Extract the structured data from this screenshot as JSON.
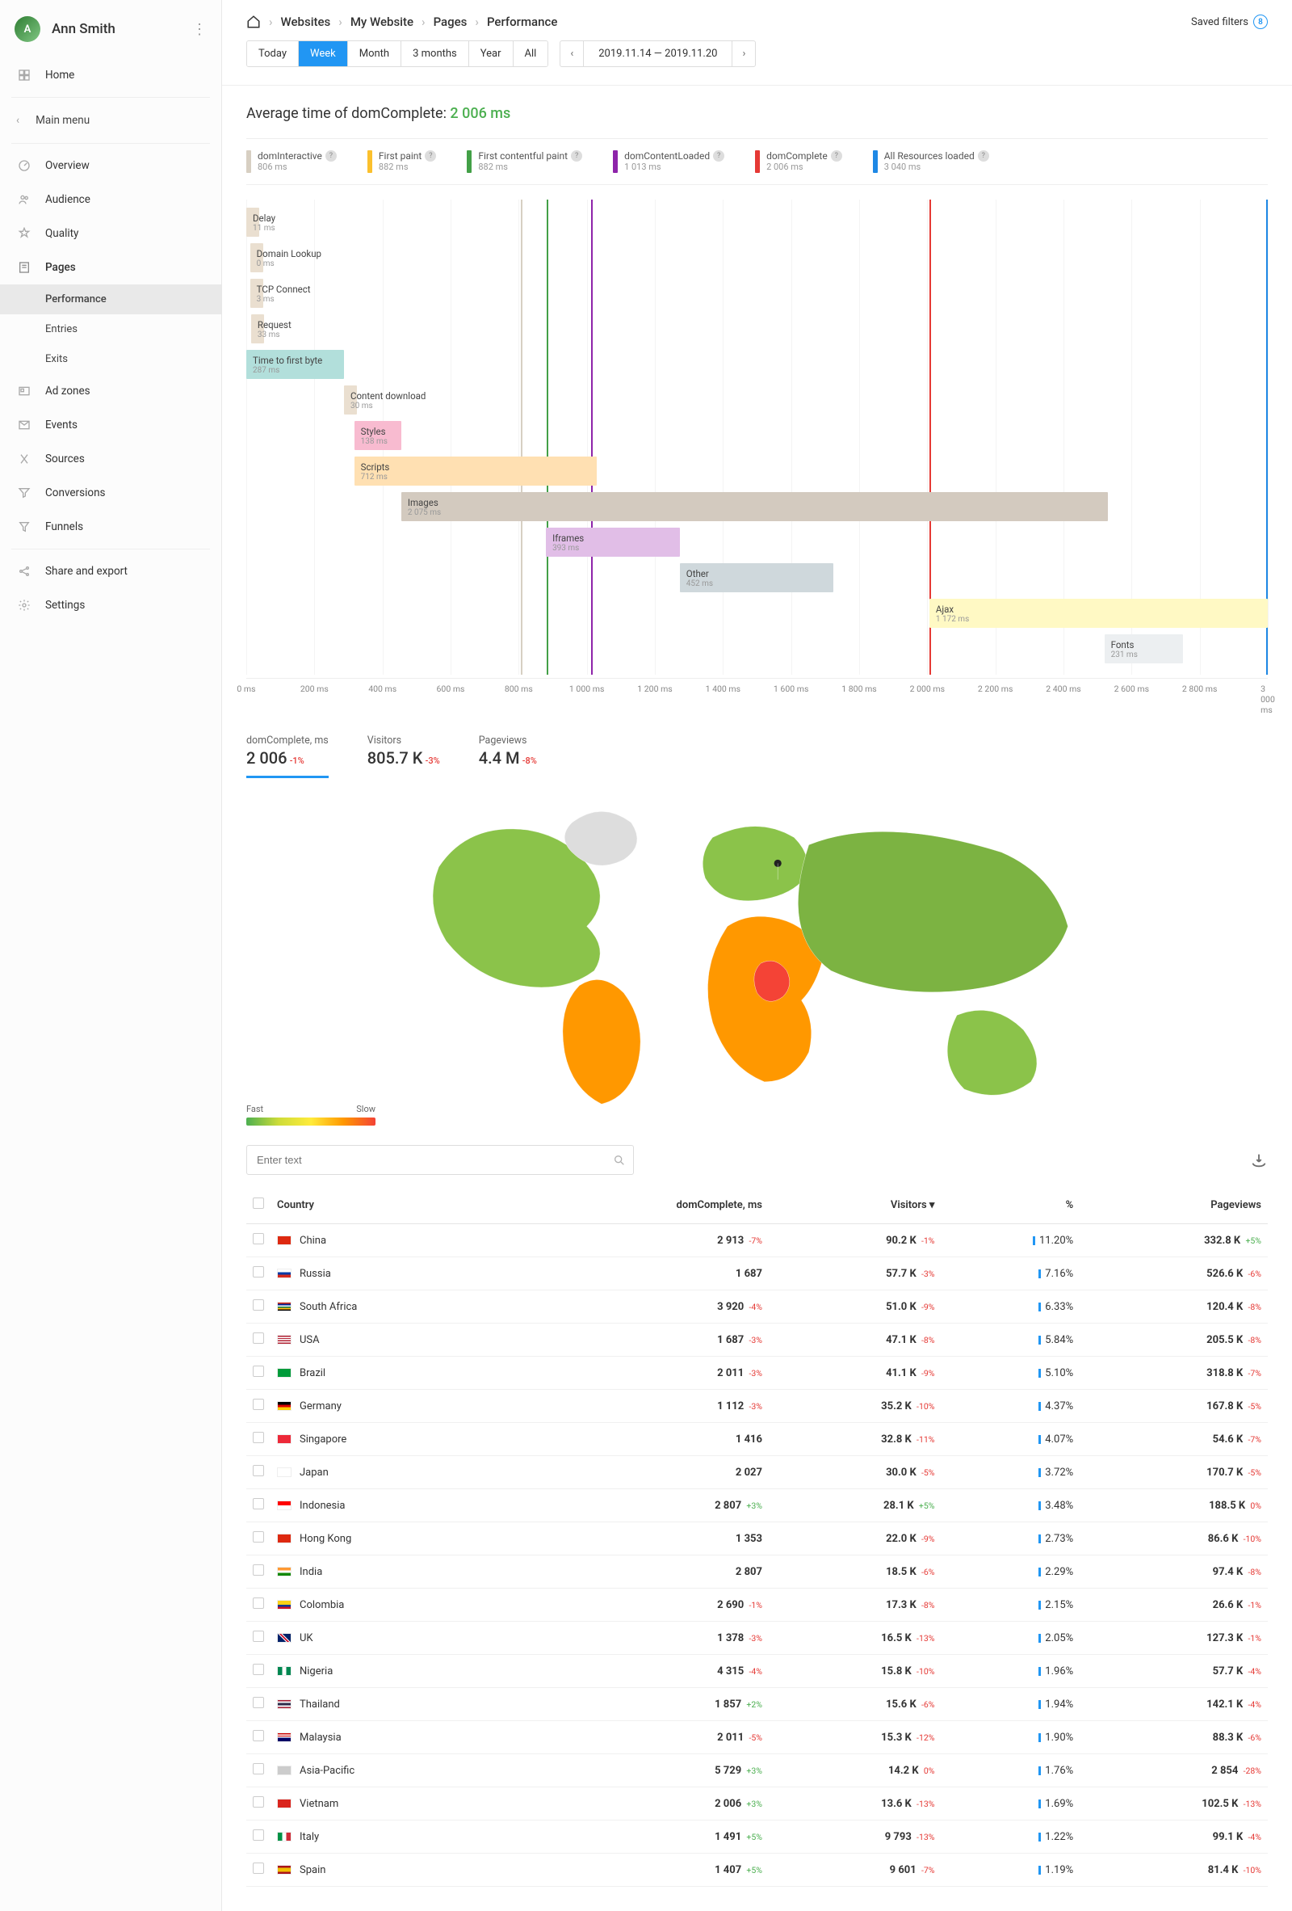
{
  "user": {
    "name": "Ann Smith"
  },
  "nav": {
    "home": "Home",
    "main_menu": "Main menu",
    "overview": "Overview",
    "audience": "Audience",
    "quality": "Quality",
    "pages": "Pages",
    "pages_sub": {
      "performance": "Performance",
      "entries": "Entries",
      "exits": "Exits"
    },
    "adzones": "Ad zones",
    "events": "Events",
    "sources": "Sources",
    "conversions": "Conversions",
    "funnels": "Funnels",
    "share": "Share and export",
    "settings": "Settings"
  },
  "breadcrumbs": [
    "Websites",
    "My Website",
    "Pages",
    "Performance"
  ],
  "saved_filters_label": "Saved filters",
  "saved_filters_count": "8",
  "periods": [
    "Today",
    "Week",
    "Month",
    "3 months",
    "Year",
    "All"
  ],
  "period_active": "Week",
  "date_range": "2019.11.14 — 2019.11.20",
  "avg_title_prefix": "Average time of domComplete:",
  "avg_value": "2 006 ms",
  "legend": [
    {
      "label": "domInteractive",
      "value": "806 ms",
      "color": "#d7cfc2"
    },
    {
      "label": "First paint",
      "value": "882 ms",
      "color": "#fbc02d"
    },
    {
      "label": "First contentful paint",
      "value": "882 ms",
      "color": "#43a047"
    },
    {
      "label": "domContentLoaded",
      "value": "1 013 ms",
      "color": "#8e24aa"
    },
    {
      "label": "domComplete",
      "value": "2 006 ms",
      "color": "#e53935"
    },
    {
      "label": "All Resources loaded",
      "value": "3 040 ms",
      "color": "#1e88e5"
    }
  ],
  "chart_data": {
    "type": "waterfall",
    "x_unit": "ms",
    "x_max": 3000,
    "ticks": [
      0,
      200,
      400,
      600,
      800,
      1000,
      1200,
      1400,
      1600,
      1800,
      2000,
      2200,
      2400,
      2600,
      2800,
      3000
    ],
    "markers": [
      {
        "name": "domInteractive",
        "at": 806,
        "color": "#d7cfc2"
      },
      {
        "name": "First paint",
        "at": 882,
        "color": "#fbc02d"
      },
      {
        "name": "First contentful paint",
        "at": 882,
        "color": "#43a047"
      },
      {
        "name": "domContentLoaded",
        "at": 1013,
        "color": "#8e24aa"
      },
      {
        "name": "domComplete",
        "at": 2006,
        "color": "#e53935"
      },
      {
        "name": "All Resources loaded",
        "at": 3040,
        "color": "#1e88e5"
      }
    ],
    "rows": [
      {
        "label": "Delay",
        "value_text": "11 ms",
        "start": 0,
        "duration": 11,
        "color": "#eadfd0"
      },
      {
        "label": "Domain Lookup",
        "value_text": "0 ms",
        "start": 11,
        "duration": 0,
        "color": "#eadfd0"
      },
      {
        "label": "TCP Connect",
        "value_text": "3 ms",
        "start": 11,
        "duration": 3,
        "color": "#eadfd0"
      },
      {
        "label": "Request",
        "value_text": "33 ms",
        "start": 14,
        "duration": 33,
        "color": "#eadfd0"
      },
      {
        "label": "Time to first byte",
        "value_text": "287 ms",
        "start": 0,
        "duration": 287,
        "color": "#b2dfdb"
      },
      {
        "label": "Content download",
        "value_text": "30 ms",
        "start": 287,
        "duration": 30,
        "color": "#eadfd0"
      },
      {
        "label": "Styles",
        "value_text": "138 ms",
        "start": 317,
        "duration": 138,
        "color": "#f8bbd0"
      },
      {
        "label": "Scripts",
        "value_text": "712 ms",
        "start": 317,
        "duration": 712,
        "color": "#ffe0b2"
      },
      {
        "label": "Images",
        "value_text": "2 075 ms",
        "start": 455,
        "duration": 2075,
        "color": "#d3cabf"
      },
      {
        "label": "Iframes",
        "value_text": "393 ms",
        "start": 880,
        "duration": 393,
        "color": "#e1bee7"
      },
      {
        "label": "Other",
        "value_text": "452 ms",
        "start": 1273,
        "duration": 452,
        "color": "#cfd8dc"
      },
      {
        "label": "Ajax",
        "value_text": "1 172 ms",
        "start": 2006,
        "duration": 994,
        "color": "#fff9c4"
      },
      {
        "label": "Fonts",
        "value_text": "231 ms",
        "start": 2520,
        "duration": 231,
        "color": "#eceff1"
      }
    ]
  },
  "stats": [
    {
      "label": "domComplete, ms",
      "value": "2 006",
      "delta": "-1%",
      "delta_sign": "neg",
      "active": true
    },
    {
      "label": "Visitors",
      "value": "805.7 K",
      "delta": "-3%",
      "delta_sign": "neg"
    },
    {
      "label": "Pageviews",
      "value": "4.4 M",
      "delta": "-8%",
      "delta_sign": "neg"
    }
  ],
  "map_legend": {
    "fast": "Fast",
    "slow": "Slow"
  },
  "search_placeholder": "Enter text",
  "table": {
    "columns": [
      "Country",
      "domComplete, ms",
      "Visitors",
      "%",
      "Pageviews"
    ],
    "sort_col": "Visitors",
    "rows": [
      {
        "flag": "#de2910",
        "country": "China",
        "dom": "2 913",
        "dom_d": "-7%",
        "dom_s": "neg",
        "vis": "90.2 K",
        "vis_d": "-1%",
        "vis_s": "neg",
        "pct": "11.20%",
        "pv": "332.8 K",
        "pv_d": "+5%",
        "pv_s": "pos"
      },
      {
        "flag": "linear-gradient(#fff 33%,#0039a6 33% 66%,#d52b1e 66%)",
        "country": "Russia",
        "dom": "1 687",
        "dom_d": "",
        "dom_s": "",
        "vis": "57.7 K",
        "vis_d": "-3%",
        "vis_s": "neg",
        "pct": "7.16%",
        "pv": "526.6 K",
        "pv_d": "-6%",
        "pv_s": "neg"
      },
      {
        "flag": "linear-gradient(#de2910 16%,#002395 16% 33%,#fff 33% 50%,#007a4d 50% 66%,#ffb612 66% 83%,#000 83%)",
        "country": "South Africa",
        "dom": "3 920",
        "dom_d": "-4%",
        "dom_s": "neg",
        "vis": "51.0 K",
        "vis_d": "-9%",
        "vis_s": "neg",
        "pct": "6.33%",
        "pv": "120.4 K",
        "pv_d": "-8%",
        "pv_s": "neg"
      },
      {
        "flag": "linear-gradient(#b22234 14%,#fff 14% 28%,#b22234 28% 42%,#fff 42% 57%,#b22234 57% 71%,#fff 71% 85%,#b22234 85%)",
        "country": "USA",
        "dom": "1 687",
        "dom_d": "-3%",
        "dom_s": "neg",
        "vis": "47.1 K",
        "vis_d": "-8%",
        "vis_s": "neg",
        "pct": "5.84%",
        "pv": "205.5 K",
        "pv_d": "-8%",
        "pv_s": "neg"
      },
      {
        "flag": "#009b3a",
        "country": "Brazil",
        "dom": "2 011",
        "dom_d": "-3%",
        "dom_s": "neg",
        "vis": "41.1 K",
        "vis_d": "-9%",
        "vis_s": "neg",
        "pct": "5.10%",
        "pv": "318.8 K",
        "pv_d": "-7%",
        "pv_s": "neg"
      },
      {
        "flag": "linear-gradient(#000 33%,#dd0000 33% 66%,#ffce00 66%)",
        "country": "Germany",
        "dom": "1 112",
        "dom_d": "-3%",
        "dom_s": "neg",
        "vis": "35.2 K",
        "vis_d": "-10%",
        "vis_s": "neg",
        "pct": "4.37%",
        "pv": "167.8 K",
        "pv_d": "-5%",
        "pv_s": "neg"
      },
      {
        "flag": "#ed2939",
        "country": "Singapore",
        "dom": "1 416",
        "dom_d": "",
        "dom_s": "",
        "vis": "32.8 K",
        "vis_d": "-11%",
        "vis_s": "neg",
        "pct": "4.07%",
        "pv": "54.6 K",
        "pv_d": "-7%",
        "pv_s": "neg"
      },
      {
        "flag": "#fff",
        "country": "Japan",
        "dom": "2 027",
        "dom_d": "",
        "dom_s": "",
        "vis": "30.0 K",
        "vis_d": "-5%",
        "vis_s": "neg",
        "pct": "3.72%",
        "pv": "170.7 K",
        "pv_d": "-5%",
        "pv_s": "neg"
      },
      {
        "flag": "linear-gradient(#ff0000 50%,#fff 50%)",
        "country": "Indonesia",
        "dom": "2 807",
        "dom_d": "+3%",
        "dom_s": "pos",
        "vis": "28.1 K",
        "vis_d": "+5%",
        "vis_s": "pos",
        "pct": "3.48%",
        "pv": "188.5 K",
        "pv_d": "0%",
        "pv_s": "neg"
      },
      {
        "flag": "#de2910",
        "country": "Hong Kong",
        "dom": "1 353",
        "dom_d": "",
        "dom_s": "",
        "vis": "22.0 K",
        "vis_d": "-9%",
        "vis_s": "neg",
        "pct": "2.73%",
        "pv": "86.6 K",
        "pv_d": "-10%",
        "pv_s": "neg"
      },
      {
        "flag": "linear-gradient(#ff9933 33%,#fff 33% 66%,#138808 66%)",
        "country": "India",
        "dom": "2 807",
        "dom_d": "",
        "dom_s": "",
        "vis": "18.5 K",
        "vis_d": "-6%",
        "vis_s": "neg",
        "pct": "2.29%",
        "pv": "97.4 K",
        "pv_d": "-8%",
        "pv_s": "neg"
      },
      {
        "flag": "linear-gradient(#fcd116 50%,#003893 50% 75%,#ce1126 75%)",
        "country": "Colombia",
        "dom": "2 690",
        "dom_d": "-1%",
        "dom_s": "neg",
        "vis": "17.3 K",
        "vis_d": "-8%",
        "vis_s": "neg",
        "pct": "2.15%",
        "pv": "26.6 K",
        "pv_d": "-1%",
        "pv_s": "neg"
      },
      {
        "flag": "linear-gradient(45deg,#012169 40%,#fff 40% 45%,#c8102e 45% 55%,#fff 55% 60%,#012169 60%)",
        "country": "UK",
        "dom": "1 378",
        "dom_d": "-3%",
        "dom_s": "neg",
        "vis": "16.5 K",
        "vis_d": "-13%",
        "vis_s": "neg",
        "pct": "2.05%",
        "pv": "127.3 K",
        "pv_d": "-1%",
        "pv_s": "neg"
      },
      {
        "flag": "linear-gradient(90deg,#008751 33%,#fff 33% 66%,#008751 66%)",
        "country": "Nigeria",
        "dom": "4 315",
        "dom_d": "-4%",
        "dom_s": "neg",
        "vis": "15.8 K",
        "vis_d": "-10%",
        "vis_s": "neg",
        "pct": "1.96%",
        "pv": "57.7 K",
        "pv_d": "-4%",
        "pv_s": "neg"
      },
      {
        "flag": "linear-gradient(#a51931 16%,#f4f5f8 16% 33%,#2d2a4a 33% 66%,#f4f5f8 66% 83%,#a51931 83%)",
        "country": "Thailand",
        "dom": "1 857",
        "dom_d": "+2%",
        "dom_s": "pos",
        "vis": "15.6 K",
        "vis_d": "-6%",
        "vis_s": "neg",
        "pct": "1.94%",
        "pv": "142.1 K",
        "pv_d": "-4%",
        "pv_s": "neg"
      },
      {
        "flag": "linear-gradient(#cc0001 14%,#fff 14% 28%,#cc0001 28% 42%,#fff 42% 57%,#010066 57%)",
        "country": "Malaysia",
        "dom": "2 011",
        "dom_d": "-5%",
        "dom_s": "neg",
        "vis": "15.3 K",
        "vis_d": "-12%",
        "vis_s": "neg",
        "pct": "1.90%",
        "pv": "88.3 K",
        "pv_d": "-6%",
        "pv_s": "neg"
      },
      {
        "flag": "#ccc",
        "country": "Asia-Pacific",
        "dom": "5 729",
        "dom_d": "+3%",
        "dom_s": "pos",
        "vis": "14.2 K",
        "vis_d": "0%",
        "vis_s": "neg",
        "pct": "1.76%",
        "pv": "2 854",
        "pv_d": "-28%",
        "pv_s": "neg"
      },
      {
        "flag": "#da251d",
        "country": "Vietnam",
        "dom": "2 006",
        "dom_d": "+3%",
        "dom_s": "pos",
        "vis": "13.6 K",
        "vis_d": "-13%",
        "vis_s": "neg",
        "pct": "1.69%",
        "pv": "102.5 K",
        "pv_d": "-13%",
        "pv_s": "neg"
      },
      {
        "flag": "linear-gradient(90deg,#009246 33%,#fff 33% 66%,#ce2b37 66%)",
        "country": "Italy",
        "dom": "1 491",
        "dom_d": "+5%",
        "dom_s": "pos",
        "vis": "9 793",
        "vis_d": "-13%",
        "vis_s": "neg",
        "pct": "1.22%",
        "pv": "99.1 K",
        "pv_d": "-4%",
        "pv_s": "neg"
      },
      {
        "flag": "linear-gradient(#aa151b 25%,#f1bf00 25% 75%,#aa151b 75%)",
        "country": "Spain",
        "dom": "1 407",
        "dom_d": "+5%",
        "dom_s": "pos",
        "vis": "9 601",
        "vis_d": "-7%",
        "vis_s": "neg",
        "pct": "1.19%",
        "pv": "81.4 K",
        "pv_d": "-10%",
        "pv_s": "neg"
      }
    ]
  }
}
